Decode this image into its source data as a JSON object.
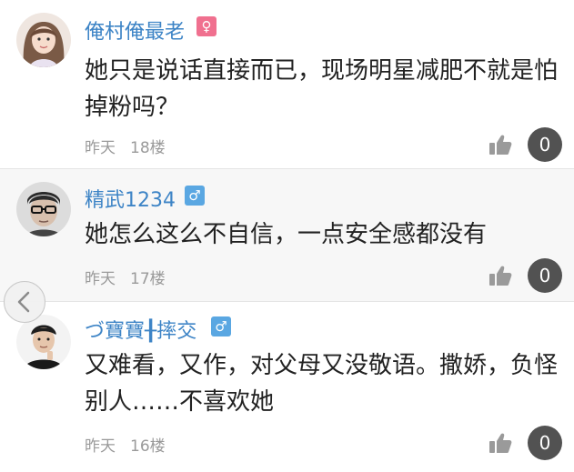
{
  "comments": [
    {
      "username": "俺村俺最老",
      "gender_icon": "female-icon",
      "gender_glyph": "♀",
      "text": "她只是说话直接而已，现场明星减肥不就是怕掉粉吗？",
      "time": "昨天",
      "floor": "18楼",
      "likes": "0"
    },
    {
      "username": "精武1234",
      "gender_icon": "male-icon",
      "gender_glyph": "♂",
      "text": "她怎么这么不自信，一点安全感都没有",
      "time": "昨天",
      "floor": "17楼",
      "likes": "0"
    },
    {
      "username": "づ寶寶╂摔交",
      "gender_icon": "male-icon",
      "gender_glyph": "♂",
      "text": "又难看，又作，对父母又没敬语。撒娇，负怪别人……不喜欢她",
      "time": "昨天",
      "floor": "16楼",
      "likes": "0"
    }
  ],
  "colors": {
    "username": "#3d84c6",
    "female_badge": "#f0708f",
    "male_badge": "#5aa7e2",
    "like_count_bg": "#525252"
  }
}
